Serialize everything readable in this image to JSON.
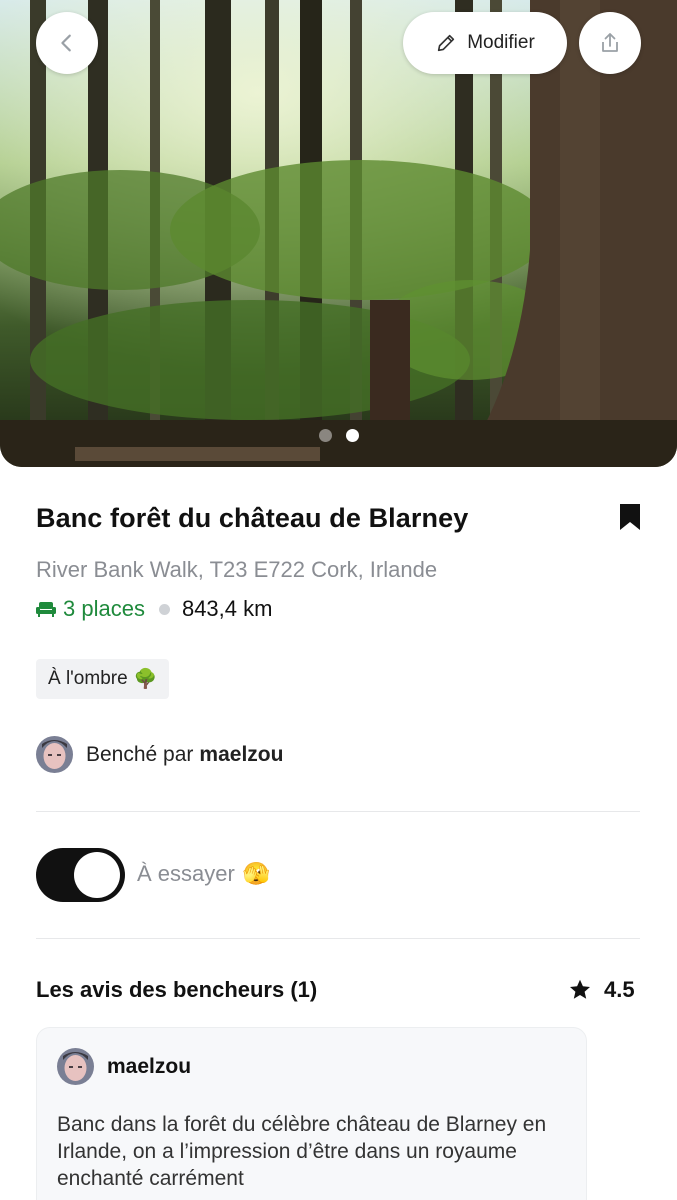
{
  "header": {
    "back_icon": "chevron-left-icon",
    "edit_label": "Modifier",
    "edit_icon": "pencil-icon",
    "share_icon": "share-icon",
    "carousel": {
      "count": 2,
      "active_index": 1
    }
  },
  "bench": {
    "title": "Banc forêt du château de Blarney",
    "address": "River Bank Walk, T23 E722 Cork, Irlande",
    "places": "3 places",
    "distance": "843,4 km",
    "tag": "À l'ombre",
    "tag_emoji": "🌳"
  },
  "author": {
    "prefix": "Benché par",
    "username": "maelzou"
  },
  "try_toggle": {
    "label": "À essayer",
    "emoji": "🫣",
    "checked": true
  },
  "reviews": {
    "title": "Les avis des bencheurs (1)",
    "rating": "4.5",
    "items": [
      {
        "username": "maelzou",
        "text": "Banc dans la forêt du célèbre château de Blarney en Irlande, on a l’impression d’être dans un royaume enchanté carrément"
      }
    ]
  },
  "colors": {
    "accent_green": "#1f8a3c",
    "muted_gray": "#8a8d93",
    "toggle_on": "#111111"
  }
}
